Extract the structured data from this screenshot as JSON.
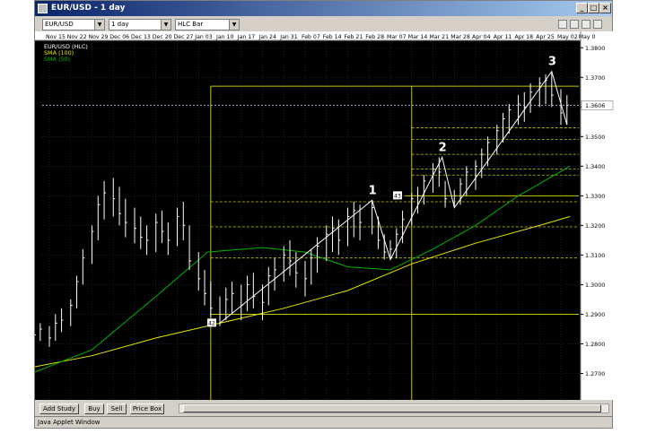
{
  "window": {
    "title": "EUR/USD - 1 day",
    "min_label": "_",
    "max_label": "□",
    "close_label": "×"
  },
  "toolbar": {
    "symbol": "EUR/USD",
    "period": "1 day",
    "chart_style": "HLC Bar"
  },
  "bottom": {
    "add_study": "Add Study",
    "buy": "Buy",
    "sell": "Sell",
    "price_box": "Price Box"
  },
  "status_text": "Java Applet Window",
  "colors": {
    "background": "#000000",
    "grid": "#2f2f5a",
    "bars": "#ffffff",
    "sma100": "#e6e600",
    "sma50": "#00b400",
    "fib": "#c8c800",
    "price_line": "#c8c8ff"
  },
  "chart_data": {
    "type": "bar",
    "style": "HLC Bar",
    "title": "EUR/USD (HLC)",
    "legend": [
      "SMA (100)",
      "SMA (50)"
    ],
    "legend_placement": "top-left",
    "x_tick_labels": [
      "Nov 15",
      "Nov 22",
      "Nov 29",
      "Dec 06",
      "Dec 13",
      "Dec 20",
      "Dec 27",
      "Jan 03",
      "Jan 10",
      "Jan 17",
      "Jan 24",
      "Jan 31",
      "Feb 07",
      "Feb 14",
      "Feb 21",
      "Feb 28",
      "Mar 07",
      "Mar 14",
      "Mar 21",
      "Mar 28",
      "Apr 04",
      "Apr 11",
      "Apr 18",
      "Apr 25",
      "May 02",
      "May 0"
    ],
    "y_tick_labels": [
      "1.3800",
      "1.3700",
      "1.3600",
      "1.3500",
      "1.3400",
      "1.3300",
      "1.3200",
      "1.3100",
      "1.3000",
      "1.2900",
      "1.2800",
      "1.2700"
    ],
    "ylim": [
      1.265,
      1.3825
    ],
    "grid": true,
    "current_price_label": "1.3606",
    "current_price": 1.3606,
    "wave_labels": [
      {
        "text": "1",
        "date": "Mar 01",
        "price": 1.3285
      },
      {
        "text": "2",
        "date": "Mar 24",
        "price": 1.343
      },
      {
        "text": "3",
        "date": "Apr 29",
        "price": 1.372
      }
    ],
    "wave_points": [
      {
        "date": "Jan 10",
        "price": 1.287
      },
      {
        "date": "Mar 01",
        "price": 1.3285
      },
      {
        "date": "Mar 07",
        "price": 1.3085
      },
      {
        "date": "Mar 24",
        "price": 1.343
      },
      {
        "date": "Mar 28",
        "price": 1.326
      },
      {
        "date": "Apr 29",
        "price": 1.372
      },
      {
        "date": "May 04",
        "price": 1.354
      }
    ],
    "box_labels": [
      {
        "text": "42",
        "date": "Jan 10",
        "price": 1.287
      },
      {
        "text": "43",
        "date": "Mar 12",
        "price": 1.33
      }
    ],
    "fib_box": {
      "date_start": "Jan 07",
      "date_mid": "Mar 14",
      "date_end": "May 08",
      "price_low": 1.29,
      "price_high": 1.367
    },
    "fib_levels": [
      1.353,
      1.349,
      1.344,
      1.339,
      1.337,
      1.328,
      1.3195,
      1.309
    ],
    "extra_hlines": [
      1.33
    ],
    "sma100": [
      [
        "Nov 09",
        1.272
      ],
      [
        "Nov 29",
        1.276
      ],
      [
        "Dec 20",
        1.282
      ],
      [
        "Jan 10",
        1.287
      ],
      [
        "Jan 31",
        1.292
      ],
      [
        "Feb 21",
        1.298
      ],
      [
        "Mar 14",
        1.307
      ],
      [
        "Apr 04",
        1.314
      ],
      [
        "Apr 25",
        1.32
      ],
      [
        "May 05",
        1.323
      ]
    ],
    "sma50": [
      [
        "Nov 09",
        1.27
      ],
      [
        "Nov 29",
        1.278
      ],
      [
        "Dec 20",
        1.296
      ],
      [
        "Jan 06",
        1.311
      ],
      [
        "Jan 24",
        1.3125
      ],
      [
        "Feb 07",
        1.311
      ],
      [
        "Feb 21",
        1.306
      ],
      [
        "Mar 07",
        1.305
      ],
      [
        "Mar 21",
        1.312
      ],
      [
        "Apr 04",
        1.32
      ],
      [
        "Apr 18",
        1.33
      ],
      [
        "May 05",
        1.34
      ]
    ],
    "bars": [
      [
        "Nov 10",
        1.289,
        1.279,
        1.283
      ],
      [
        "Nov 12",
        1.287,
        1.281,
        1.285
      ],
      [
        "Nov 15",
        1.286,
        1.279,
        1.282
      ],
      [
        "Nov 17",
        1.29,
        1.281,
        1.287
      ],
      [
        "Nov 19",
        1.292,
        1.284,
        1.288
      ],
      [
        "Nov 22",
        1.295,
        1.286,
        1.293
      ],
      [
        "Nov 24",
        1.303,
        1.292,
        1.301
      ],
      [
        "Nov 26",
        1.312,
        1.3,
        1.309
      ],
      [
        "Nov 29",
        1.32,
        1.307,
        1.318
      ],
      [
        "Dec 01",
        1.33,
        1.315,
        1.327
      ],
      [
        "Dec 03",
        1.335,
        1.322,
        1.331
      ],
      [
        "Dec 06",
        1.336,
        1.323,
        1.329
      ],
      [
        "Dec 08",
        1.333,
        1.32,
        1.324
      ],
      [
        "Dec 10",
        1.329,
        1.316,
        1.321
      ],
      [
        "Dec 13",
        1.326,
        1.314,
        1.319
      ],
      [
        "Dec 15",
        1.323,
        1.312,
        1.316
      ],
      [
        "Dec 17",
        1.32,
        1.31,
        1.315
      ],
      [
        "Dec 20",
        1.324,
        1.311,
        1.321
      ],
      [
        "Dec 22",
        1.325,
        1.314,
        1.318
      ],
      [
        "Dec 24",
        1.321,
        1.31,
        1.315
      ],
      [
        "Dec 27",
        1.326,
        1.313,
        1.323
      ],
      [
        "Dec 29",
        1.328,
        1.315,
        1.32
      ],
      [
        "Dec 31",
        1.32,
        1.305,
        1.308
      ],
      [
        "Jan 03",
        1.311,
        1.298,
        1.302
      ],
      [
        "Jan 05",
        1.305,
        1.293,
        1.297
      ],
      [
        "Jan 07",
        1.301,
        1.289,
        1.292
      ],
      [
        "Jan 10",
        1.296,
        1.286,
        1.29
      ],
      [
        "Jan 12",
        1.299,
        1.288,
        1.295
      ],
      [
        "Jan 14",
        1.301,
        1.29,
        1.297
      ],
      [
        "Jan 17",
        1.3,
        1.288,
        1.293
      ],
      [
        "Jan 19",
        1.303,
        1.291,
        1.3
      ],
      [
        "Jan 21",
        1.304,
        1.292,
        1.296
      ],
      [
        "Jan 24",
        1.3,
        1.288,
        1.294
      ],
      [
        "Jan 26",
        1.306,
        1.293,
        1.303
      ],
      [
        "Jan 28",
        1.309,
        1.298,
        1.305
      ],
      [
        "Jan 31",
        1.313,
        1.301,
        1.31
      ],
      [
        "Feb 02",
        1.315,
        1.303,
        1.308
      ],
      [
        "Feb 04",
        1.311,
        1.299,
        1.304
      ],
      [
        "Feb 07",
        1.308,
        1.296,
        1.302
      ],
      [
        "Feb 09",
        1.312,
        1.3,
        1.309
      ],
      [
        "Feb 11",
        1.316,
        1.304,
        1.313
      ],
      [
        "Feb 14",
        1.32,
        1.308,
        1.317
      ],
      [
        "Feb 16",
        1.323,
        1.311,
        1.319
      ],
      [
        "Feb 18",
        1.322,
        1.31,
        1.315
      ],
      [
        "Feb 21",
        1.326,
        1.313,
        1.323
      ],
      [
        "Feb 23",
        1.328,
        1.316,
        1.325
      ],
      [
        "Feb 25",
        1.327,
        1.315,
        1.321
      ],
      [
        "Mar 01",
        1.3285,
        1.317,
        1.326
      ],
      [
        "Mar 03",
        1.323,
        1.312,
        1.315
      ],
      [
        "Mar 05",
        1.317,
        1.3085,
        1.311
      ],
      [
        "Mar 07",
        1.315,
        1.3085,
        1.312
      ],
      [
        "Mar 09",
        1.319,
        1.309,
        1.317
      ],
      [
        "Mar 11",
        1.325,
        1.314,
        1.322
      ],
      [
        "Mar 14",
        1.331,
        1.32,
        1.329
      ],
      [
        "Mar 16",
        1.333,
        1.324,
        1.33
      ],
      [
        "Mar 18",
        1.337,
        1.327,
        1.335
      ],
      [
        "Mar 21",
        1.341,
        1.331,
        1.339
      ],
      [
        "Mar 23",
        1.343,
        1.333,
        1.338
      ],
      [
        "Mar 25",
        1.335,
        1.326,
        1.329
      ],
      [
        "Mar 28",
        1.332,
        1.326,
        1.33
      ],
      [
        "Mar 30",
        1.336,
        1.327,
        1.334
      ],
      [
        "Apr 01",
        1.34,
        1.33,
        1.338
      ],
      [
        "Apr 04",
        1.342,
        1.332,
        1.34
      ],
      [
        "Apr 06",
        1.346,
        1.336,
        1.344
      ],
      [
        "Apr 08",
        1.35,
        1.34,
        1.348
      ],
      [
        "Apr 11",
        1.354,
        1.344,
        1.352
      ],
      [
        "Apr 13",
        1.358,
        1.348,
        1.356
      ],
      [
        "Apr 15",
        1.361,
        1.351,
        1.359
      ],
      [
        "Apr 18",
        1.364,
        1.354,
        1.361
      ],
      [
        "Apr 20",
        1.365,
        1.355,
        1.36
      ],
      [
        "Apr 22",
        1.368,
        1.358,
        1.365
      ],
      [
        "Apr 25",
        1.37,
        1.36,
        1.368
      ],
      [
        "Apr 27",
        1.371,
        1.361,
        1.369
      ],
      [
        "Apr 29",
        1.372,
        1.36,
        1.364
      ],
      [
        "May 02",
        1.366,
        1.354,
        1.358
      ],
      [
        "May 04",
        1.364,
        1.354,
        1.3606
      ]
    ]
  }
}
